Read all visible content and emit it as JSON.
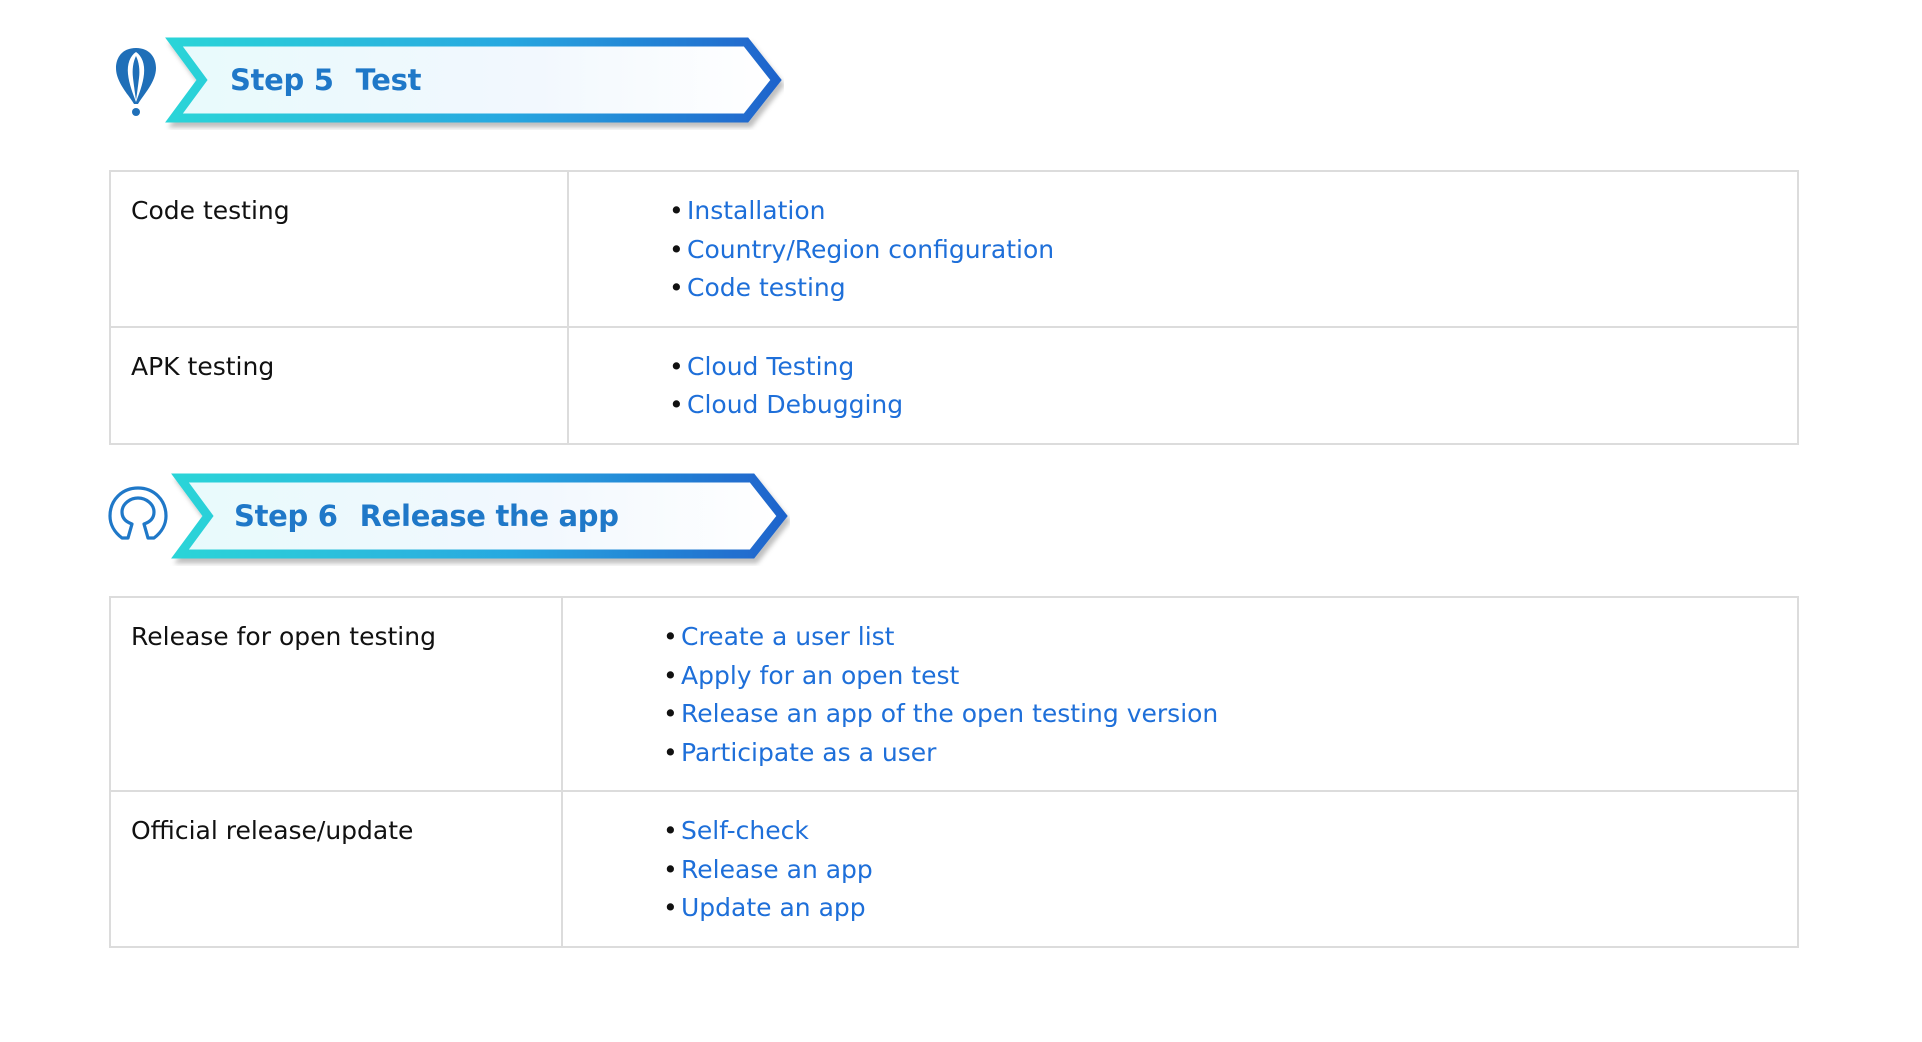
{
  "step5": {
    "number": "Step 5",
    "title": "Test",
    "icon": "balloon-pin-icon",
    "rows": [
      {
        "label": "Code testing",
        "links": [
          "Installation",
          "Country/Region configuration",
          "Code testing"
        ]
      },
      {
        "label": "APK testing",
        "links": [
          "Cloud Testing",
          "Cloud Debugging"
        ]
      }
    ]
  },
  "step6": {
    "number": "Step 6",
    "title": "Release the app",
    "icon": "open-source-ring-icon",
    "rows": [
      {
        "label": "Release for open testing",
        "links": [
          "Create a user list",
          "Apply for an open test",
          "Release an app of the open testing version",
          "Participate as a user"
        ]
      },
      {
        "label": "Official release/update",
        "links": [
          "Self-check",
          "Release an app",
          "Update an app"
        ]
      }
    ]
  },
  "colors": {
    "link": "#1e6fd9",
    "banner_text": "#1f78c8",
    "banner_cyan": "#2ad0d8",
    "banner_blue": "#1f6fd0",
    "border": "#dcdcdc"
  }
}
